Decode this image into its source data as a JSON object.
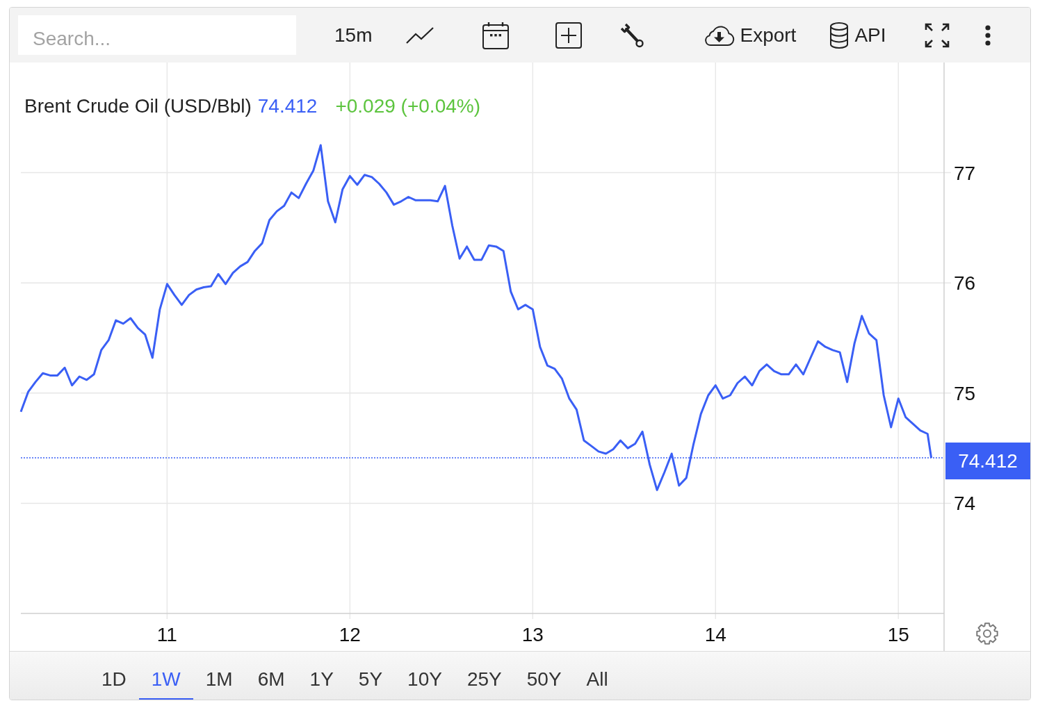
{
  "toolbar": {
    "search": {
      "placeholder": "Search..."
    },
    "buttons": [
      {
        "kind": "text",
        "label": "15m"
      },
      {
        "kind": "line-chart"
      },
      {
        "kind": "calendar"
      },
      {
        "kind": "plus"
      },
      {
        "kind": "wrench"
      },
      {
        "kind": "cloud",
        "label": "Export"
      },
      {
        "kind": "database",
        "label": "API"
      },
      {
        "kind": "expand"
      },
      {
        "kind": "more"
      }
    ]
  },
  "chart": {
    "legend": {
      "name": "Brent Crude Oil (USD/Bbl)",
      "price": "74.412",
      "change": "+0.029 (+0.04%)"
    },
    "chart_data": {
      "type": "line",
      "grid": true,
      "xlim": [
        10.2,
        15.25
      ],
      "ylim": [
        73,
        78
      ],
      "xticks": [
        11,
        12,
        13,
        14,
        15
      ],
      "yticks": [
        74,
        75,
        76,
        77
      ],
      "ref_lines": [
        {
          "axis": "y",
          "value": 74.412,
          "label": "74.412"
        }
      ],
      "x": [
        10.2,
        10.24,
        10.28,
        10.32,
        10.36,
        10.4,
        10.44,
        10.48,
        10.52,
        10.56,
        10.6,
        10.64,
        10.68,
        10.72,
        10.76,
        10.8,
        10.84,
        10.88,
        10.92,
        10.96,
        11,
        11.04,
        11.08,
        11.12,
        11.16,
        11.2,
        11.24,
        11.28,
        11.32,
        11.36,
        11.4,
        11.44,
        11.48,
        11.52,
        11.56,
        11.6,
        11.64,
        11.68,
        11.72,
        11.76,
        11.8,
        11.84,
        11.88,
        11.92,
        11.96,
        12,
        12.04,
        12.08,
        12.12,
        12.16,
        12.2,
        12.24,
        12.28,
        12.32,
        12.36,
        12.4,
        12.44,
        12.48,
        12.52,
        12.56,
        12.6,
        12.64,
        12.68,
        12.72,
        12.76,
        12.8,
        12.84,
        12.88,
        12.92,
        12.96,
        13,
        13.04,
        13.08,
        13.12,
        13.16,
        13.2,
        13.24,
        13.28,
        13.32,
        13.36,
        13.4,
        13.44,
        13.48,
        13.52,
        13.56,
        13.6,
        13.64,
        13.68,
        13.72,
        13.76,
        13.8,
        13.84,
        13.88,
        13.92,
        13.96,
        14,
        14.04,
        14.08,
        14.12,
        14.16,
        14.2,
        14.24,
        14.28,
        14.32,
        14.36,
        14.4,
        14.44,
        14.48,
        14.52,
        14.56,
        14.6,
        14.64,
        14.68,
        14.72,
        14.76,
        14.8,
        14.84,
        14.88,
        14.92,
        14.96,
        15,
        15.04,
        15.08,
        15.12,
        15.16,
        15.18
      ],
      "series": [
        {
          "color": "#3a5ff5",
          "values": [
            74.83,
            75.01,
            75.1,
            75.18,
            75.16,
            75.16,
            75.23,
            75.07,
            75.15,
            75.12,
            75.17,
            75.39,
            75.48,
            75.66,
            75.63,
            75.68,
            75.59,
            75.53,
            75.32,
            75.76,
            75.99,
            75.89,
            75.8,
            75.89,
            75.94,
            75.96,
            75.97,
            76.08,
            75.99,
            76.09,
            76.15,
            76.19,
            76.29,
            76.36,
            76.57,
            76.65,
            76.7,
            76.82,
            76.77,
            76.9,
            77.02,
            77.25,
            76.74,
            76.55,
            76.85,
            76.97,
            76.89,
            76.98,
            76.96,
            76.9,
            76.82,
            76.71,
            76.74,
            76.78,
            76.75,
            76.75,
            76.75,
            76.74,
            76.88,
            76.52,
            76.22,
            76.33,
            76.21,
            76.21,
            76.34,
            76.33,
            76.29,
            75.92,
            75.76,
            75.8,
            75.76,
            75.42,
            75.25,
            75.22,
            75.13,
            74.95,
            74.85,
            74.57,
            74.52,
            74.47,
            74.45,
            74.49,
            74.57,
            74.5,
            74.54,
            74.65,
            74.35,
            74.12,
            74.28,
            74.45,
            74.16,
            74.23,
            74.54,
            74.81,
            74.98,
            75.07,
            74.95,
            74.98,
            75.09,
            75.15,
            75.07,
            75.2,
            75.26,
            75.2,
            75.17,
            75.17,
            75.26,
            75.17,
            75.32,
            75.47,
            75.42,
            75.39,
            75.37,
            75.1,
            75.45,
            75.7,
            75.54,
            75.48,
            74.98,
            74.69,
            74.95,
            74.78,
            74.72,
            74.66,
            74.63,
            74.412
          ]
        }
      ]
    }
  },
  "ranges": [
    {
      "label": "1D",
      "selected": false
    },
    {
      "label": "1W",
      "selected": true
    },
    {
      "label": "1M",
      "selected": false
    },
    {
      "label": "6M",
      "selected": false
    },
    {
      "label": "1Y",
      "selected": false
    },
    {
      "label": "5Y",
      "selected": false
    },
    {
      "label": "10Y",
      "selected": false
    },
    {
      "label": "25Y",
      "selected": false
    },
    {
      "label": "50Y",
      "selected": false
    },
    {
      "label": "All",
      "selected": false
    }
  ]
}
